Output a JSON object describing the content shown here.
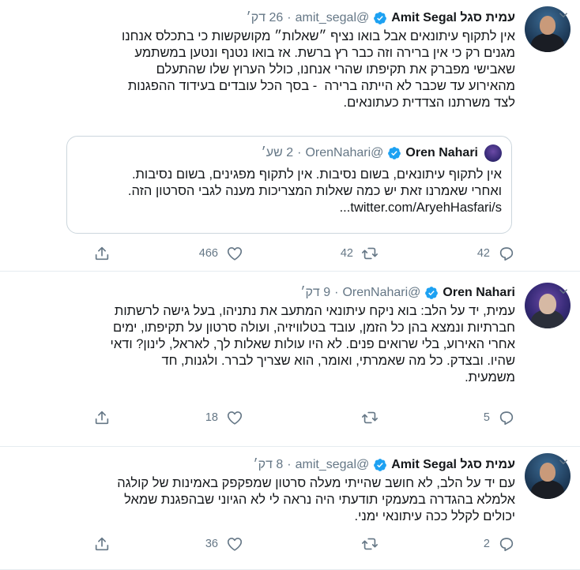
{
  "colors": {
    "accent": "#1da1f2",
    "text": "#14171a",
    "muted": "#657786",
    "border": "#e6ecf0"
  },
  "tweets": [
    {
      "display_name": "עמית סגל Amit Segal",
      "handle": "@amit_segal",
      "separator": "·",
      "time": "26 דק׳",
      "text": "אין לתקוף עיתונאים אבל בואו נציף ״שאלות״ מקושקשות כי בתכלס אנחנו\nמגנים רק כי אין ברירה וזה כבר רץ ברשת. אז בואו נטנף ונטען במשתמע\nשאבישי מפברק את תקיפתו שהרי אנחנו, כולל הערוץ שלו שהתעלם\nמהאירוע עד שכבר לא הייתה ברירה  - בסך הכל עובדים בעידוד ההפגנות\nלצד משרתנו הצדדית כעתונאים.",
      "quote": {
        "display_name": "Oren Nahari",
        "handle": "@OrenNahari",
        "separator": "·",
        "time": "2 שע׳",
        "text": "אין לתקוף עיתונאים, בשום נסיבות. אין לתקוף מפגינים, בשום נסיבות.\nואחרי שאמרנו זאת יש כמה שאלות המצריכות מענה לגבי הסרטון הזה.\ntwitter.com/AryehHasfari/s..."
      },
      "replies": "42",
      "retweets": "42",
      "likes": "466"
    },
    {
      "display_name": "Oren Nahari",
      "handle": "@OrenNahari",
      "separator": "·",
      "time": "9 דק׳",
      "text": "עמית, יד על הלב: בוא ניקח עיתונאי המתעב את נתניהו, בעל גישה לרשתות\nחברתיות ונמצא בהן כל הזמן, עובד בטלוויזיה, ועולה סרטון על תקיפתו, ימים\nאחרי האירוע, בלי שרואים פנים. לא היו עולות שאלות לך, לאראל, לינון? ודאי\nשהיו. ובצדק. כל מה שאמרתי, ואומר, הוא שצריך לברר. ולגנות, חד\nמשמעית.",
      "replies": "5",
      "retweets": "",
      "likes": "18"
    },
    {
      "display_name": "עמית סגל Amit Segal",
      "handle": "@amit_segal",
      "separator": "·",
      "time": "8 דק׳",
      "text": "עם יד על הלב, לא חושב שהייתי מעלה סרטון שמפקפק באמינות של קולגה\nאלמלא בהגדרה במעמקי תודעתי היה נראה לי לא הגיוני שבהפגנת שמאל\nיכולים לקלל ככה עיתונאי ימני.",
      "replies": "2",
      "retweets": "",
      "likes": "36"
    }
  ]
}
